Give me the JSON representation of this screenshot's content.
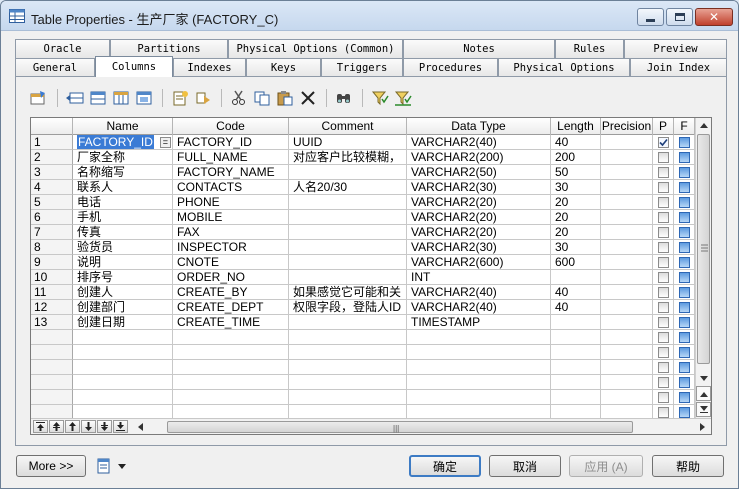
{
  "window": {
    "title": "Table Properties - 生产厂家 (FACTORY_C)"
  },
  "tabs_row1": [
    "Oracle",
    "Partitions",
    "Physical Options (Common)",
    "Notes",
    "Rules",
    "Preview"
  ],
  "tabs_row2": [
    "General",
    "Columns",
    "Indexes",
    "Keys",
    "Triggers",
    "Procedures",
    "Physical Options",
    "Join Index"
  ],
  "active_tab": "Columns",
  "toolbar_icons": [
    "properties-icon",
    "insert-row-icon",
    "add-row-icon",
    "add-columns-icon",
    "add-attributes-icon",
    "create-domain-icon",
    "attach-domain-icon",
    "cut-icon",
    "copy-icon",
    "paste-icon",
    "delete-icon",
    "find-icon",
    "filter-icon",
    "clear-filter-icon"
  ],
  "columns_header": [
    "Name",
    "Code",
    "Comment",
    "Data Type",
    "Length",
    "Precision",
    "P",
    "F"
  ],
  "rows": [
    {
      "n": "1",
      "name": "FACTORY_ID",
      "code": "FACTORY_ID",
      "comment": "UUID",
      "type": "VARCHAR2(40)",
      "length": "40",
      "precision": "",
      "p": true
    },
    {
      "n": "2",
      "name": "厂家全称",
      "code": "FULL_NAME",
      "comment": "对应客户比较模糊，",
      "type": "VARCHAR2(200)",
      "length": "200",
      "precision": "",
      "p": false
    },
    {
      "n": "3",
      "name": "名称缩写",
      "code": "FACTORY_NAME",
      "comment": "",
      "type": "VARCHAR2(50)",
      "length": "50",
      "precision": "",
      "p": false
    },
    {
      "n": "4",
      "name": "联系人",
      "code": "CONTACTS",
      "comment": "人名20/30",
      "type": "VARCHAR2(30)",
      "length": "30",
      "precision": "",
      "p": false
    },
    {
      "n": "5",
      "name": "电话",
      "code": "PHONE",
      "comment": "",
      "type": "VARCHAR2(20)",
      "length": "20",
      "precision": "",
      "p": false
    },
    {
      "n": "6",
      "name": "手机",
      "code": "MOBILE",
      "comment": "",
      "type": "VARCHAR2(20)",
      "length": "20",
      "precision": "",
      "p": false
    },
    {
      "n": "7",
      "name": "传真",
      "code": "FAX",
      "comment": "",
      "type": "VARCHAR2(20)",
      "length": "20",
      "precision": "",
      "p": false
    },
    {
      "n": "8",
      "name": "验货员",
      "code": "INSPECTOR",
      "comment": "",
      "type": "VARCHAR2(30)",
      "length": "30",
      "precision": "",
      "p": false
    },
    {
      "n": "9",
      "name": "说明",
      "code": "CNOTE",
      "comment": "",
      "type": "VARCHAR2(600)",
      "length": "600",
      "precision": "",
      "p": false
    },
    {
      "n": "10",
      "name": "排序号",
      "code": "ORDER_NO",
      "comment": "",
      "type": "INT",
      "length": "",
      "precision": "",
      "p": false
    },
    {
      "n": "11",
      "name": "创建人",
      "code": "CREATE_BY",
      "comment": "如果感觉它可能和关",
      "type": "VARCHAR2(40)",
      "length": "40",
      "precision": "",
      "p": false
    },
    {
      "n": "12",
      "name": "创建部门",
      "code": "CREATE_DEPT",
      "comment": "权限字段，登陆人ID",
      "type": "VARCHAR2(40)",
      "length": "40",
      "precision": "",
      "p": false
    },
    {
      "n": "13",
      "name": "创建日期",
      "code": "CREATE_TIME",
      "comment": "",
      "type": "TIMESTAMP",
      "length": "",
      "precision": "",
      "p": false
    }
  ],
  "empty_rows": 6,
  "selected_cell_button": "=",
  "buttons": {
    "more": "More >>",
    "ok": "确定",
    "cancel": "取消",
    "apply": "应用 (A)",
    "help": "帮助"
  },
  "colors": {
    "titlebar": "#c6d8ee",
    "selection": "#3a7bd5",
    "foreign_check": "#5d9be0"
  }
}
